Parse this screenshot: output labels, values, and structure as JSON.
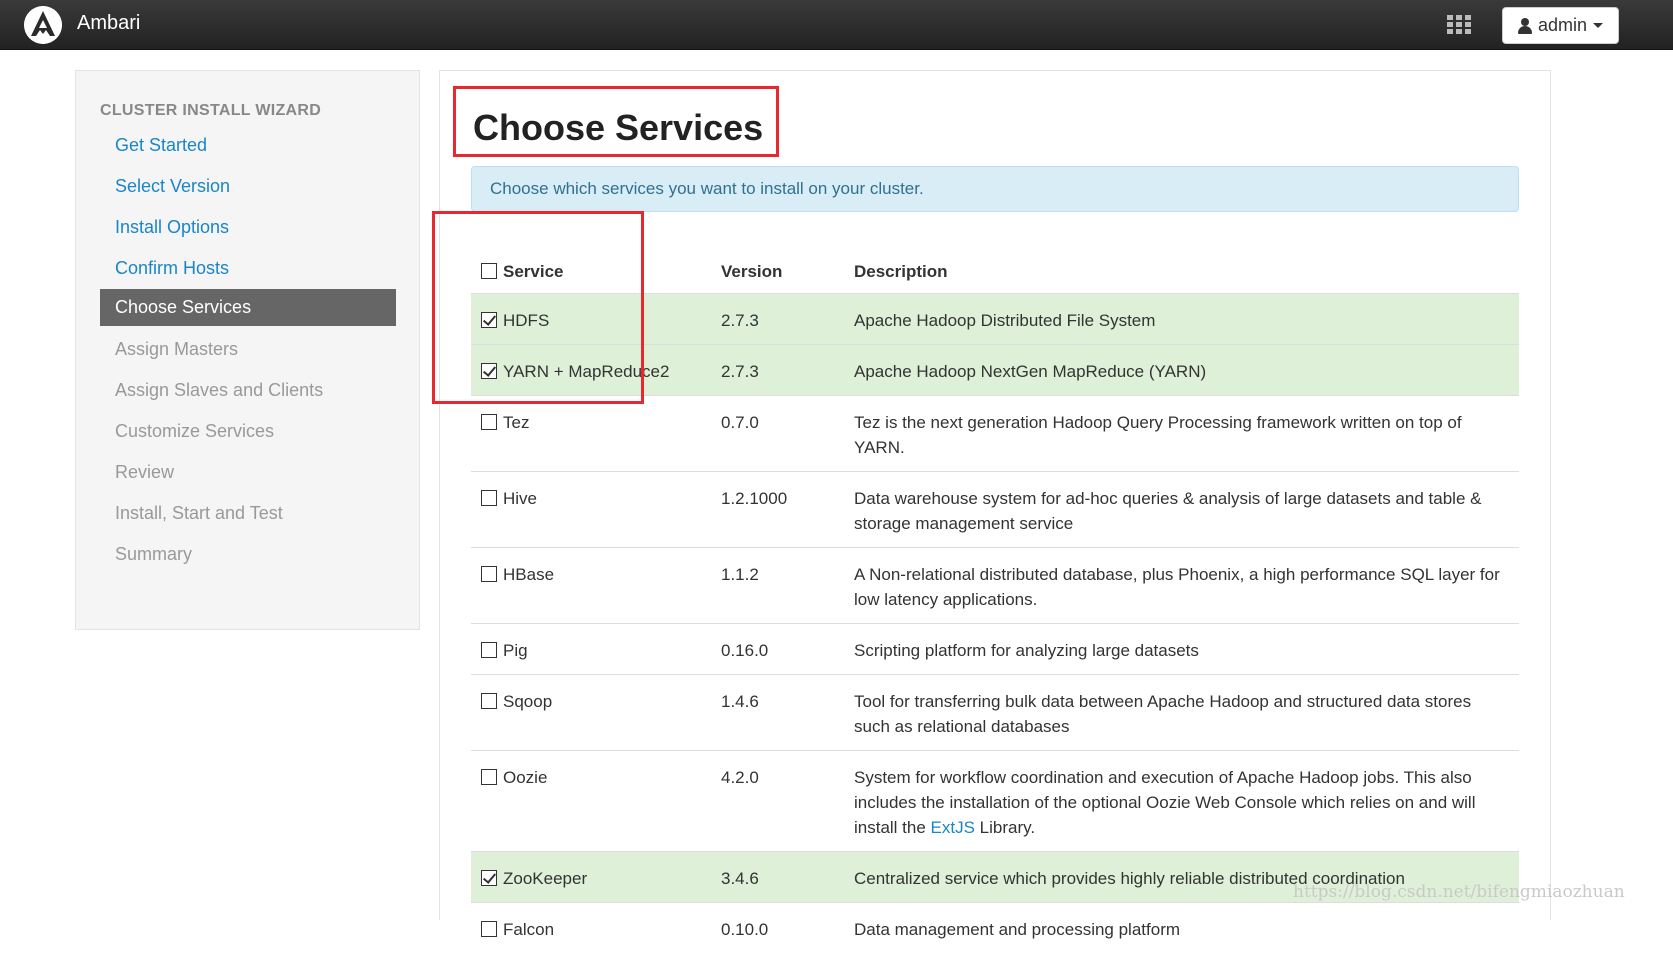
{
  "header": {
    "brand": "Ambari",
    "user_label": "admin"
  },
  "sidebar": {
    "title": "CLUSTER INSTALL WIZARD",
    "steps": [
      {
        "label": "Get Started",
        "state": "done"
      },
      {
        "label": "Select Version",
        "state": "done"
      },
      {
        "label": "Install Options",
        "state": "done"
      },
      {
        "label": "Confirm Hosts",
        "state": "done"
      },
      {
        "label": "Choose Services",
        "state": "active"
      },
      {
        "label": "Assign Masters",
        "state": "pending"
      },
      {
        "label": "Assign Slaves and Clients",
        "state": "pending"
      },
      {
        "label": "Customize Services",
        "state": "pending"
      },
      {
        "label": "Review",
        "state": "pending"
      },
      {
        "label": "Install, Start and Test",
        "state": "pending"
      },
      {
        "label": "Summary",
        "state": "pending"
      }
    ]
  },
  "main": {
    "title": "Choose Services",
    "alert": "Choose which services you want to install on your cluster.",
    "columns": {
      "service": "Service",
      "version": "Version",
      "description": "Description"
    },
    "services": [
      {
        "name": "HDFS",
        "version": "2.7.3",
        "description": "Apache Hadoop Distributed File System",
        "checked": true
      },
      {
        "name": "YARN + MapReduce2",
        "version": "2.7.3",
        "description": "Apache Hadoop NextGen MapReduce (YARN)",
        "checked": true
      },
      {
        "name": "Tez",
        "version": "0.7.0",
        "description": "Tez is the next generation Hadoop Query Processing framework written on top of YARN.",
        "checked": false
      },
      {
        "name": "Hive",
        "version": "1.2.1000",
        "description": "Data warehouse system for ad-hoc queries & analysis of large datasets and table & storage management service",
        "checked": false
      },
      {
        "name": "HBase",
        "version": "1.1.2",
        "description": "A Non-relational distributed database, plus Phoenix, a high performance SQL layer for low latency applications.",
        "checked": false
      },
      {
        "name": "Pig",
        "version": "0.16.0",
        "description": "Scripting platform for analyzing large datasets",
        "checked": false
      },
      {
        "name": "Sqoop",
        "version": "1.4.6",
        "description": "Tool for transferring bulk data between Apache Hadoop and structured data stores such as relational databases",
        "checked": false
      },
      {
        "name": "Oozie",
        "version": "4.2.0",
        "description": "System for workflow coordination and execution of Apache Hadoop jobs. This also includes the installation of the optional Oozie Web Console which relies on and will install the ",
        "description_link": "ExtJS",
        "description_suffix": " Library.",
        "checked": false
      },
      {
        "name": "ZooKeeper",
        "version": "3.4.6",
        "description": "Centralized service which provides highly reliable distributed coordination",
        "checked": true
      },
      {
        "name": "Falcon",
        "version": "0.10.0",
        "description": "Data management and processing platform",
        "checked": false
      }
    ]
  },
  "watermark": "https://blog.csdn.net/bifengmiaozhuan"
}
